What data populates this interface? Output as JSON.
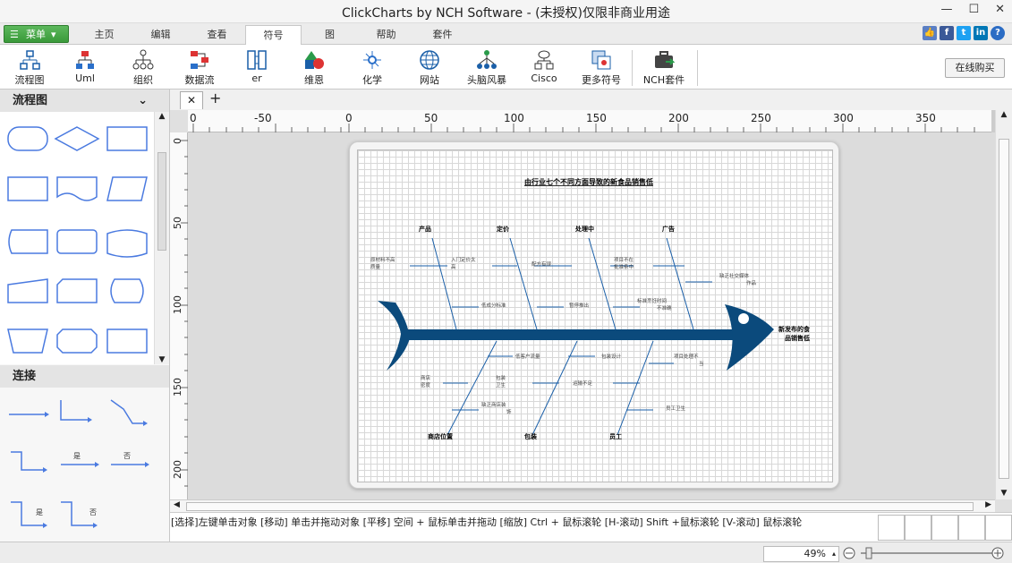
{
  "window": {
    "title": "ClickCharts by NCH Software - (未授权)仅限非商业用途",
    "minimize": "—",
    "maximize": "☐",
    "close": "✕"
  },
  "menu": {
    "button_label": "菜单"
  },
  "tabs": [
    "主页",
    "编辑",
    "查看",
    "符号",
    "图",
    "帮助",
    "套件"
  ],
  "active_tab": "符号",
  "toolbar": {
    "items": [
      "流程图",
      "Uml",
      "组织",
      "数据流",
      "er",
      "维恩",
      "化学",
      "网站",
      "头脑风暴",
      "Cisco",
      "更多符号",
      "NCH套件"
    ],
    "buy_label": "在线购买"
  },
  "sidebar": {
    "flow_header": "流程图",
    "connect_header": "连接",
    "yes": "是",
    "no": "否"
  },
  "doc_tab": {
    "close": "✕",
    "add": "+"
  },
  "ruler_h": [
    "-50",
    "0",
    "50",
    "100",
    "150",
    "200",
    "250",
    "300",
    "350"
  ],
  "ruler_v": [
    "0",
    "50",
    "100",
    "150",
    "200"
  ],
  "diagram": {
    "title": "由行业七个不同方面导致的新食品销售低",
    "head": [
      "新发布的食",
      "品销售低"
    ],
    "categories_top": [
      "产品",
      "定价",
      "处理中",
      "广告"
    ],
    "categories_bottom": [
      "商店位置",
      "包装",
      "员工"
    ],
    "causes": {
      "c1": [
        "原材料不高",
        "质量"
      ],
      "c2": [
        "入门定价太",
        "高"
      ],
      "c3": "配方有误",
      "c4": [
        "项目不在",
        "批准条中"
      ],
      "c5": [
        "缺乏社交媒体",
        "作品"
      ],
      "c6": "低成分标准",
      "c7": "暂停推出",
      "c8": [
        "标准烹饪时间",
        "不准确"
      ],
      "c9": "低客户流量",
      "c10": "包装设计",
      "c11": [
        "项目处理不",
        "当"
      ],
      "c12": [
        "商店",
        "密度"
      ],
      "c13": [
        "包装",
        "卫生"
      ],
      "c14": "运输不足",
      "c15": [
        "缺乏商店装",
        "饰"
      ],
      "c16": "员工卫生"
    }
  },
  "status": {
    "hint": "[选择]左键单击对象 [移动] 单击并拖动对象 [平移] 空间 + 鼠标单击并拖动 [缩放] Ctrl + 鼠标滚轮 [H-滚动] Shift +鼠标滚轮 [V-滚动] 鼠标滚轮",
    "zoom": "49%"
  },
  "colors": {
    "accent_green": "#3a9a3a",
    "fish": "#0b4a7c",
    "link_blue": "#1a5fa8"
  }
}
